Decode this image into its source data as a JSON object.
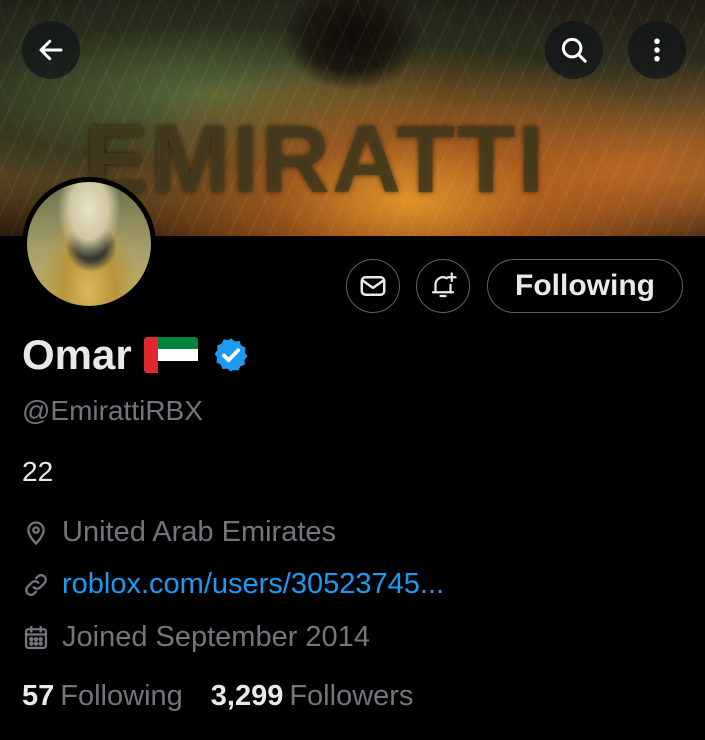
{
  "header": {
    "banner_text": "EMIRATTI",
    "back_icon": "arrow-left-icon",
    "search_icon": "search-icon",
    "more_icon": "more-vertical-icon"
  },
  "actions": {
    "message_icon": "envelope-icon",
    "notify_icon": "bell-plus-icon",
    "following_label": "Following"
  },
  "profile": {
    "display_name": "Omar",
    "flag": "UAE flag",
    "verified": true,
    "handle": "@EmirattiRBX",
    "bio": "22",
    "location": "United Arab Emirates",
    "link": "roblox.com/users/30523745...",
    "joined": "Joined September 2014"
  },
  "stats": {
    "following_count": "57",
    "following_label": "Following",
    "followers_count": "3,299",
    "followers_label": "Followers"
  },
  "colors": {
    "background": "#000000",
    "primary_text": "#e7e9ea",
    "secondary_text": "#71767b",
    "link": "#1d9bf0",
    "verified_badge": "#1d9bf0"
  }
}
